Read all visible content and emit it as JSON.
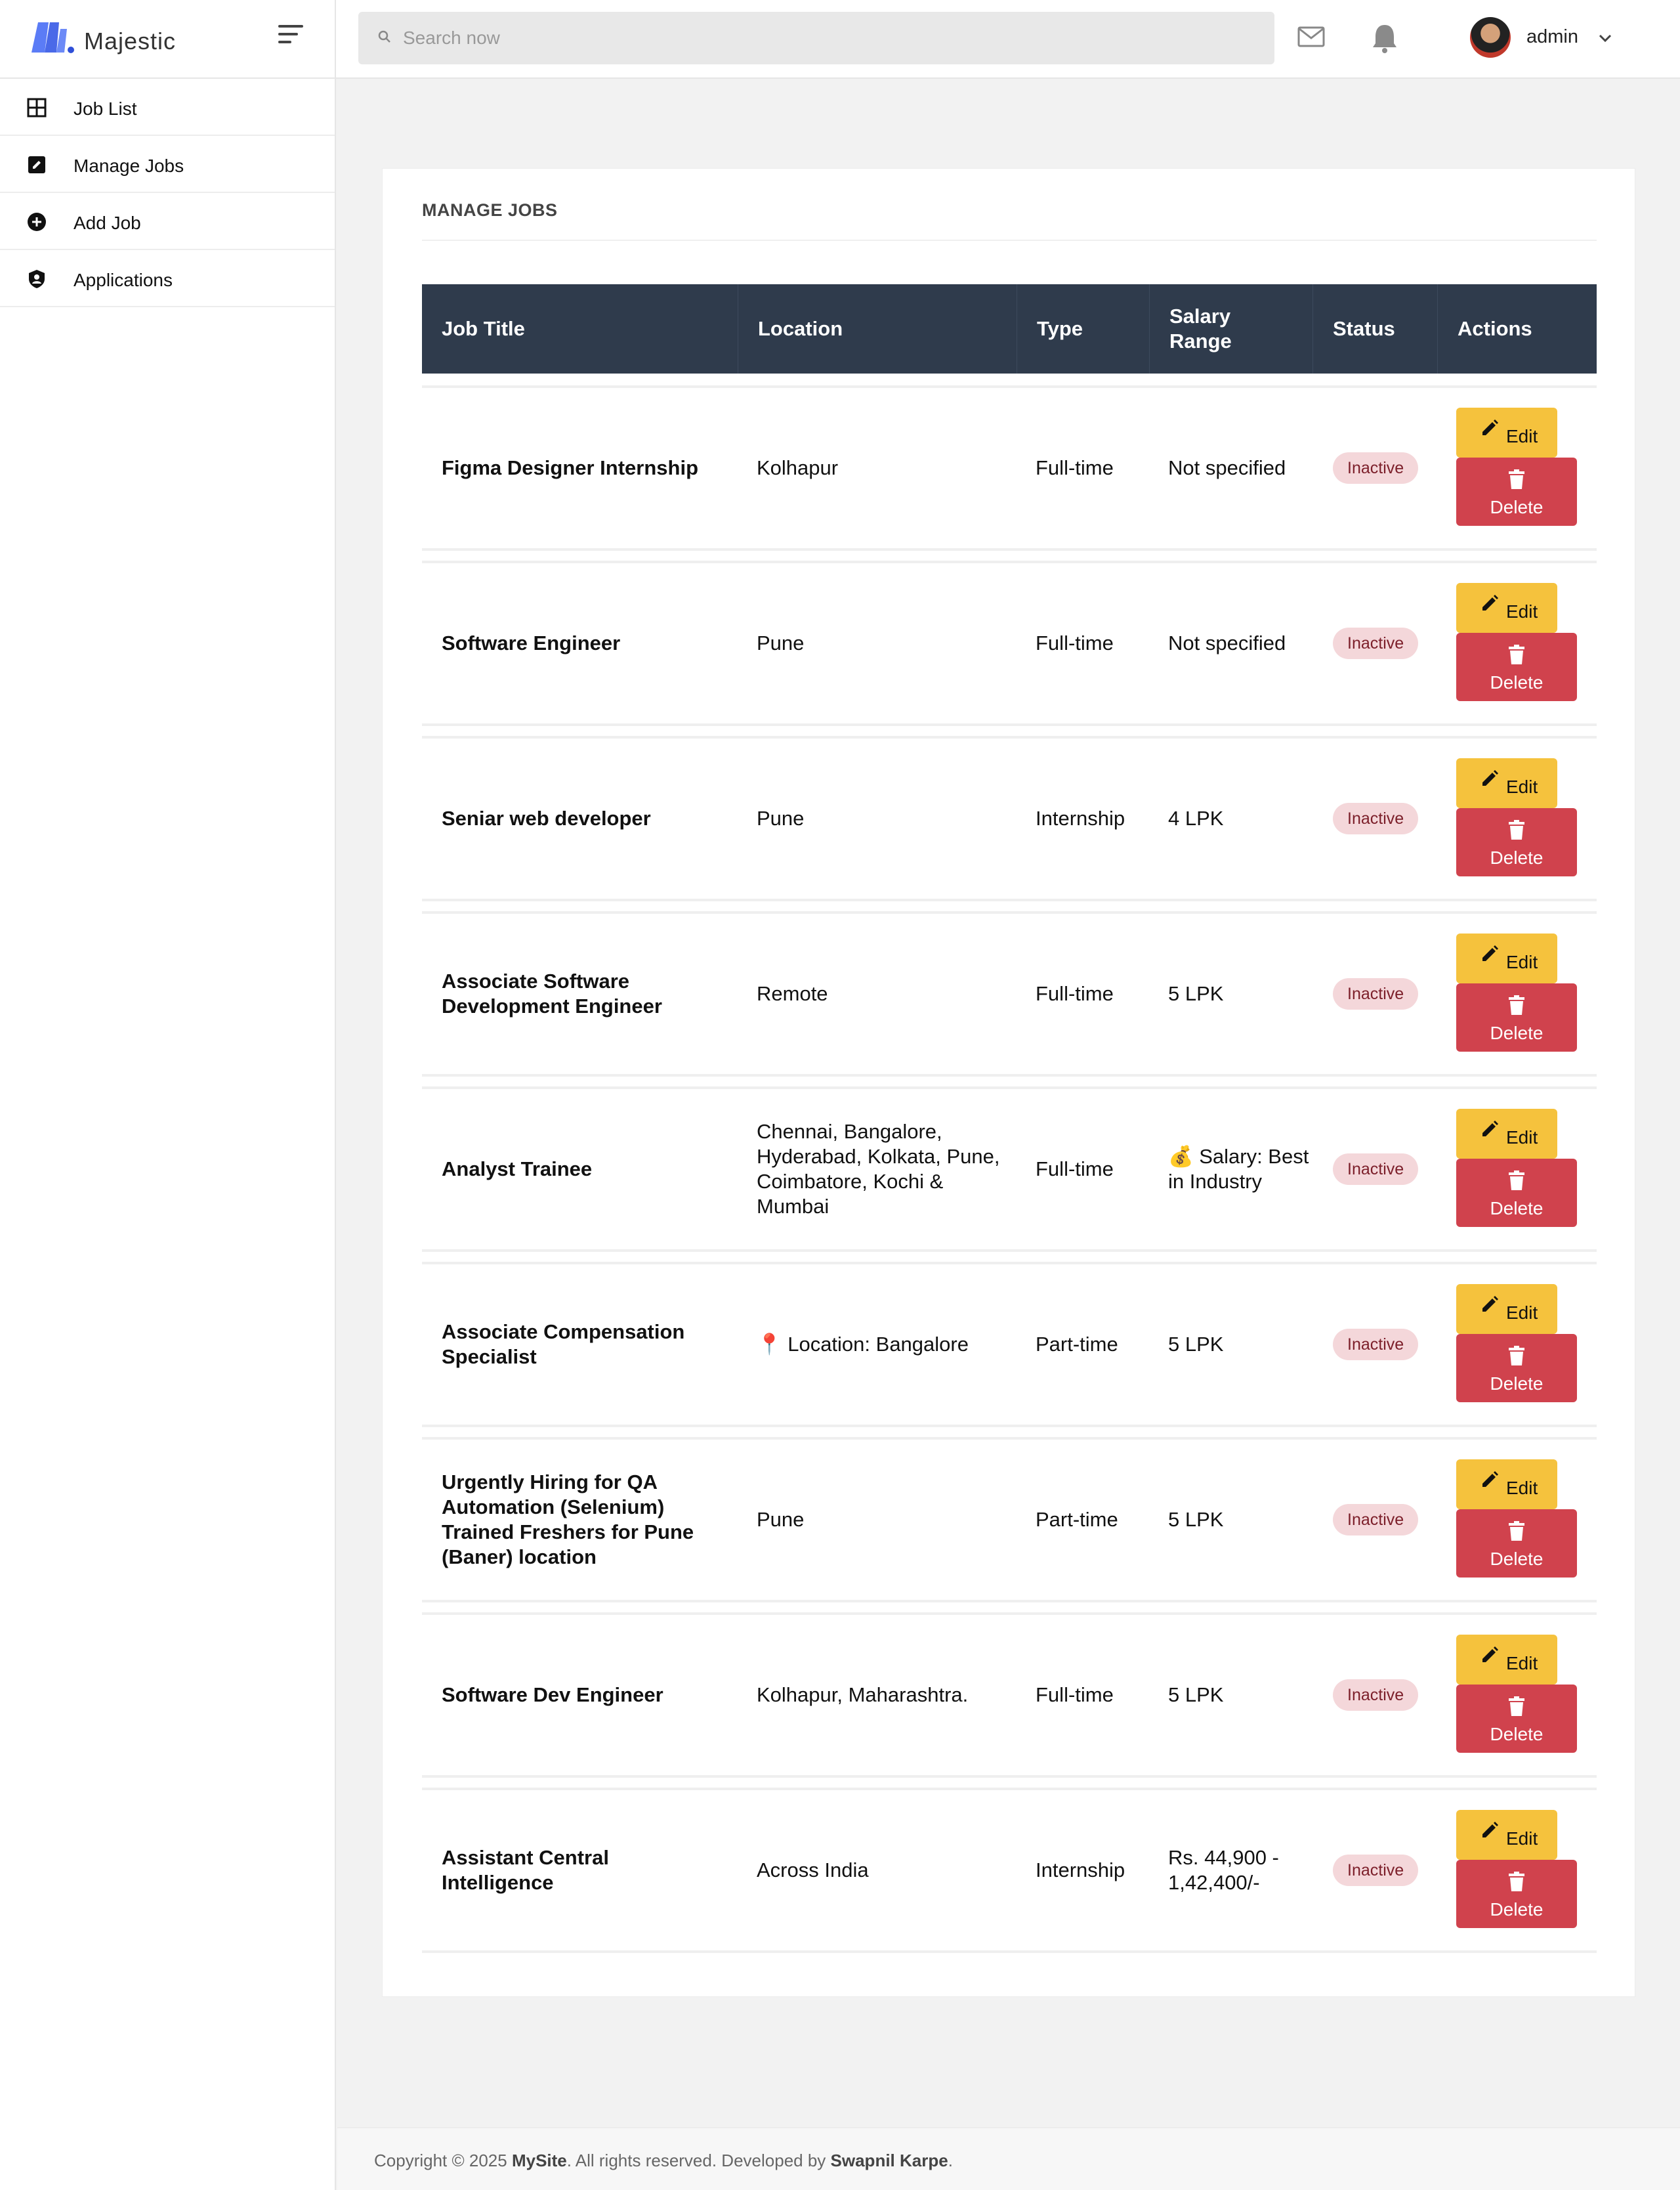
{
  "brand": {
    "name": "Majestic"
  },
  "search": {
    "placeholder": "Search now"
  },
  "header": {
    "user_name": "admin"
  },
  "sidebar": {
    "items": [
      {
        "label": "Job List",
        "icon": "grid-icon"
      },
      {
        "label": "Manage Jobs",
        "icon": "edit-square-icon"
      },
      {
        "label": "Add Job",
        "icon": "plus-circle-icon"
      },
      {
        "label": "Applications",
        "icon": "shield-user-icon"
      }
    ]
  },
  "main": {
    "title": "MANAGE JOBS",
    "columns": [
      "Job Title",
      "Location",
      "Type",
      "Salary Range",
      "Status",
      "Actions"
    ],
    "edit_label": "Edit",
    "delete_label": "Delete",
    "rows": [
      {
        "title": "Figma Designer Internship",
        "location": "Kolhapur",
        "type": "Full-time",
        "salary": "Not specified",
        "status": "Inactive"
      },
      {
        "title": "Software Engineer",
        "location": "Pune",
        "type": "Full-time",
        "salary": "Not specified",
        "status": "Inactive"
      },
      {
        "title": "Seniar web developer",
        "location": "Pune",
        "type": "Internship",
        "salary": "4 LPK",
        "status": "Inactive"
      },
      {
        "title": "Associate Software Development Engineer",
        "location": "Remote",
        "type": "Full-time",
        "salary": "5 LPK",
        "status": "Inactive"
      },
      {
        "title": "Analyst Trainee",
        "location": "Chennai, Bangalore, Hyderabad, Kolkata, Pune, Coimbatore, Kochi & Mumbai",
        "type": "Full-time",
        "salary": "💰 Salary: Best in Industry",
        "status": "Inactive"
      },
      {
        "title": "Associate Compensation Specialist",
        "location": "📍 Location: Bangalore",
        "type": "Part-time",
        "salary": "5 LPK",
        "status": "Inactive"
      },
      {
        "title": "Urgently Hiring for QA Automation (Selenium) Trained Freshers for Pune (Baner) location",
        "location": "Pune",
        "type": "Part-time",
        "salary": "5 LPK",
        "status": "Inactive"
      },
      {
        "title": "Software Dev Engineer",
        "location": "Kolhapur, Maharashtra.",
        "type": "Full-time",
        "salary": "5 LPK",
        "status": "Inactive"
      },
      {
        "title": "Assistant Central Intelligence",
        "location": "Across India",
        "type": "Internship",
        "salary": "Rs. 44,900 - 1,42,400/-",
        "status": "Inactive"
      }
    ]
  },
  "footer": {
    "prefix": "Copyright © 2025 ",
    "site": "MySite",
    "middle": ". All rights reserved. Developed by ",
    "author": "Swapnil Karpe",
    "suffix": "."
  },
  "colors": {
    "header_bg": "#2f3b4c",
    "edit": "#f5c23d",
    "delete": "#d0424d",
    "badge_bg": "#f4d7da",
    "accent": "#4b6ef5"
  }
}
